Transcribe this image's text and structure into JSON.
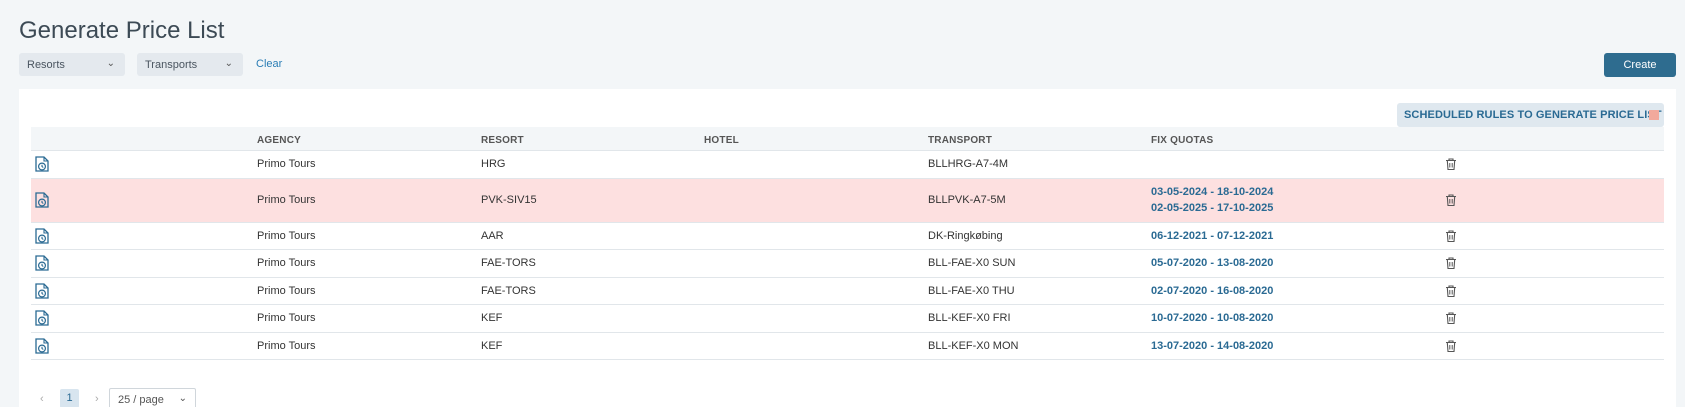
{
  "page": {
    "title": "Generate Price List"
  },
  "filters": {
    "resorts_label": "Resorts",
    "transports_label": "Transports",
    "clear_label": "Clear",
    "create_label": "Create"
  },
  "scheduled_badge": {
    "label": "SCHEDULED RULES TO GENERATE PRICE LIST",
    "swatch_color": "#f2a99c"
  },
  "table": {
    "columns": [
      "AGENCY",
      "RESORT",
      "HOTEL",
      "TRANSPORT",
      "FIX QUOTAS"
    ],
    "rows": [
      {
        "agency": "Primo Tours",
        "resort": "HRG",
        "hotel": "",
        "transport": "BLLHRG-A7-4M",
        "quota1": "",
        "quota2": "",
        "highlighted": false
      },
      {
        "agency": "Primo Tours",
        "resort": "PVK-SIV15",
        "hotel": "",
        "transport": "BLLPVK-A7-5M",
        "quota1": "03-05-2024 - 18-10-2024",
        "quota2": "02-05-2025 - 17-10-2025",
        "highlighted": true
      },
      {
        "agency": "Primo Tours",
        "resort": "AAR",
        "hotel": "",
        "transport": "DK-Ringkøbing",
        "quota1": "06-12-2021 - 07-12-2021",
        "quota2": "",
        "highlighted": false
      },
      {
        "agency": "Primo Tours",
        "resort": "FAE-TORS",
        "hotel": "",
        "transport": "BLL-FAE-X0 SUN",
        "quota1": "05-07-2020 - 13-08-2020",
        "quota2": "",
        "highlighted": false
      },
      {
        "agency": "Primo Tours",
        "resort": "FAE-TORS",
        "hotel": "",
        "transport": "BLL-FAE-X0 THU",
        "quota1": "02-07-2020 - 16-08-2020",
        "quota2": "",
        "highlighted": false
      },
      {
        "agency": "Primo Tours",
        "resort": "KEF",
        "hotel": "",
        "transport": "BLL-KEF-X0 FRI",
        "quota1": "10-07-2020 - 10-08-2020",
        "quota2": "",
        "highlighted": false
      },
      {
        "agency": "Primo Tours",
        "resort": "KEF",
        "hotel": "",
        "transport": "BLL-KEF-X0 MON",
        "quota1": "13-07-2020 - 14-08-2020",
        "quota2": "",
        "highlighted": false
      }
    ]
  },
  "pagination": {
    "prev": "‹",
    "current_page": "1",
    "next": "›",
    "page_size": "25 / page"
  },
  "colors": {
    "accent": "#2e6c8f",
    "highlight_row": "#fde0e0",
    "link": "#2a7db5"
  }
}
